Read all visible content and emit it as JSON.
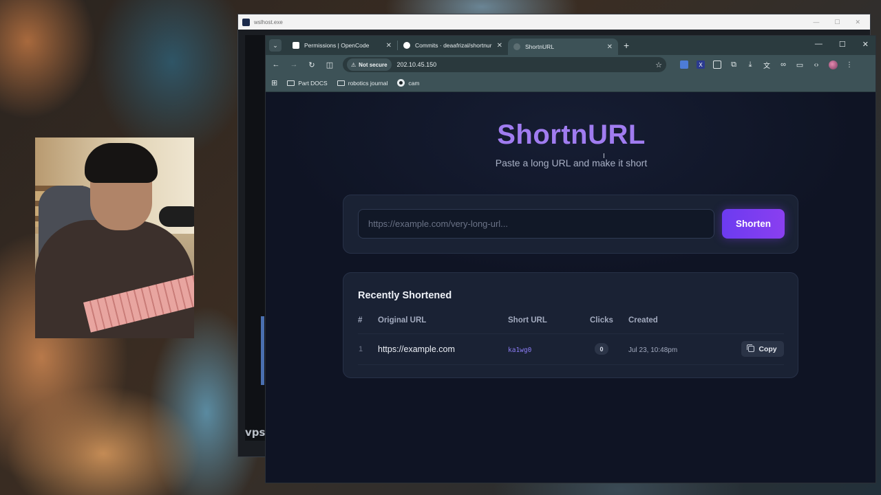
{
  "back_window": {
    "title": "wslhost.exe",
    "terminal_label": "vps"
  },
  "browser": {
    "tabs": [
      {
        "title": "Permissions | OpenCode",
        "favicon_color": "#ffffff"
      },
      {
        "title": "Commits · deaafrizal/shortnurl",
        "favicon_color": "#ffffff"
      },
      {
        "title": "ShortnURL",
        "favicon_color": "#5c6e72",
        "active": true
      }
    ],
    "new_tab": "+",
    "address": {
      "security_label": "Not secure",
      "url": "202.10.45.150"
    },
    "bookmarks": [
      {
        "label": "Part DOCS",
        "icon": "folder-icon"
      },
      {
        "label": "robotics journal",
        "icon": "folder-icon"
      },
      {
        "label": "cam",
        "icon": "cam-icon"
      }
    ]
  },
  "app": {
    "title": "ShortnURL",
    "subtitle": "Paste a long URL and make it short",
    "input_placeholder": "https://example.com/very-long-url...",
    "input_value": "",
    "shorten_label": "Shorten",
    "accent_color": "#7c3aed",
    "recent": {
      "title": "Recently Shortened",
      "columns": [
        "#",
        "Original URL",
        "Short URL",
        "Clicks",
        "Created"
      ],
      "rows": [
        {
          "num": "1",
          "original": "https://example.com",
          "short": "ka1wg0",
          "clicks": "0",
          "created": "Jul 23, 10:48pm",
          "copy_label": "Copy"
        }
      ]
    }
  }
}
